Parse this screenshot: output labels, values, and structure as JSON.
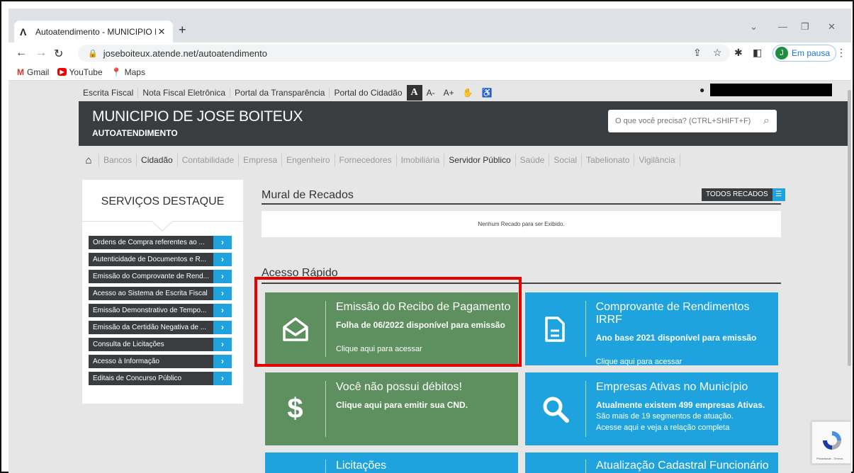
{
  "browser": {
    "tab_title": "Autoatendimento - MUNICIPIO D",
    "new_tab": "+",
    "url": "joseboiteux.atende.net/autoatendimento",
    "profile_initial": "J",
    "profile_label": "Em pausa",
    "bookmarks": [
      {
        "label": "Gmail"
      },
      {
        "label": "YouTube"
      },
      {
        "label": "Maps"
      }
    ]
  },
  "topbar": {
    "links": [
      "Escrita Fiscal",
      "Nota Fiscal Eletrônica",
      "Portal da Transparência",
      "Portal do Cidadão"
    ],
    "font_a": "A",
    "font_minus": "A-",
    "font_plus": "A+"
  },
  "header": {
    "title": "MUNICIPIO DE JOSE BOITEUX",
    "subtitle": "AUTOATENDIMENTO",
    "search_placeholder": "O que você precisa? (CTRL+SHIFT+F)"
  },
  "categories": [
    {
      "label": "Bancos",
      "active": false
    },
    {
      "label": "Cidadão",
      "active": true
    },
    {
      "label": "Contabilidade",
      "active": false
    },
    {
      "label": "Empresa",
      "active": false
    },
    {
      "label": "Engenheiro",
      "active": false
    },
    {
      "label": "Fornecedores",
      "active": false
    },
    {
      "label": "Imobiliária",
      "active": false
    },
    {
      "label": "Servidor Público",
      "active": true
    },
    {
      "label": "Saúde",
      "active": false
    },
    {
      "label": "Social",
      "active": false
    },
    {
      "label": "Tabelionato",
      "active": false
    },
    {
      "label": "Vigilância",
      "active": false
    }
  ],
  "sidebar": {
    "title": "SERVIÇOS DESTAQUE",
    "items": [
      "Ordens de Compra referentes ao ...",
      "Autenticidade de Documentos e R...",
      "Emissão do Comprovante de Rend...",
      "Acesso ao Sistema de Escrita Fiscal",
      "Emissão Demonstrativo de Tempo...",
      "Emissão da Certidão Negativa de ...",
      "Consulta de Licitações",
      "Acesso à Informação",
      "Editais de Concurso Público"
    ]
  },
  "mural": {
    "title": "Mural de Recados",
    "button": "TODOS RECADOS",
    "empty": "Nenhum Recado para ser Exibido."
  },
  "acesso": {
    "title": "Acesso Rápido",
    "cards": [
      {
        "title": "Emissão do Recibo de Pagamento",
        "sub": "Folha de 06/2022 disponível para emissão",
        "link": "Clique aqui para acessar",
        "icon": "envelope-open-icon",
        "color": "#5e8f5e"
      },
      {
        "title": "Comprovante de Rendimentos IRRF",
        "sub": "Ano base 2021 disponível para emissão",
        "link": "Clique aqui para acessar",
        "icon": "document-icon",
        "color": "#1ea3de"
      },
      {
        "title": "Você não possui débitos!",
        "sub": "Clique aqui para emitir sua CND.",
        "icon": "dollar-icon",
        "color": "#5e8f5e"
      },
      {
        "title": "Empresas Ativas no Município",
        "sub": "Atualmente existem 499 empresas Ativas.",
        "note1": "São mais de 19 segmentos de atuação.",
        "note2": "Acesse aqui e veja a relação completa",
        "icon": "magnifier-icon",
        "color": "#1ea3de"
      },
      {
        "title": "Licitações",
        "color": "#1ea3de"
      },
      {
        "title": "Atualização Cadastral Funcionário",
        "color": "#1ea3de"
      }
    ]
  },
  "recaptcha": {
    "label": "Privacidade - Termos"
  }
}
